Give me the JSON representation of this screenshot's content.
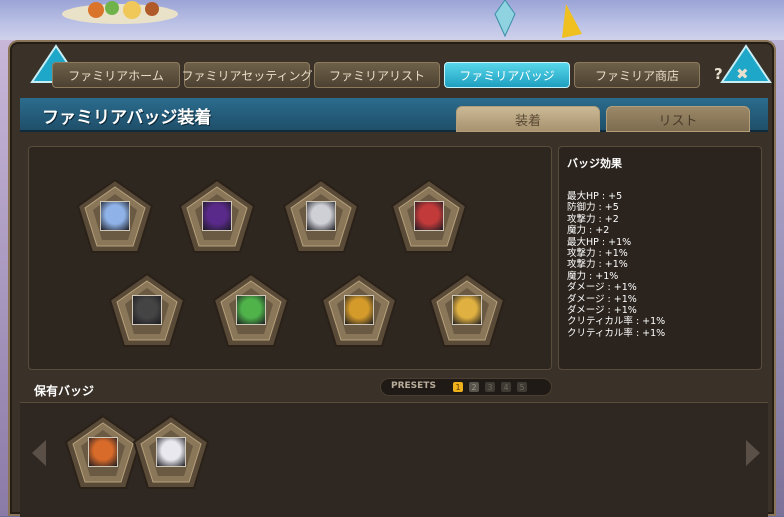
{
  "window": {
    "title": "ファミリアバッジ装着",
    "help_label": "?",
    "close_label": "✖"
  },
  "tabs": [
    {
      "label": "ファミリアホーム",
      "active": false
    },
    {
      "label": "ファミリアセッティング",
      "active": false
    },
    {
      "label": "ファミリアリスト",
      "active": false
    },
    {
      "label": "ファミリアバッジ",
      "active": true
    },
    {
      "label": "ファミリア商店",
      "active": false
    }
  ],
  "subtabs": [
    {
      "label": "装着",
      "active": true
    },
    {
      "label": "リスト",
      "active": false
    }
  ],
  "equipped_badges": [
    {
      "icon": "frost-feather-badge-icon",
      "color": "#8fb3e8"
    },
    {
      "icon": "dark-portal-badge-icon",
      "color": "#5a2a8a"
    },
    {
      "icon": "silver-box-badge-icon",
      "color": "#cfcfd6"
    },
    {
      "icon": "red-white-beast-badge-icon",
      "color": "#c23a3a"
    },
    {
      "icon": "shadow-golem-badge-icon",
      "color": "#444444"
    },
    {
      "icon": "witch-slime-badge-icon",
      "color": "#4fb34a"
    },
    {
      "icon": "golden-gear-badge-icon",
      "color": "#d59b2a"
    },
    {
      "icon": "golden-chest-badge-icon",
      "color": "#e0b040"
    }
  ],
  "effects": {
    "title": "バッジ効果",
    "lines": [
      "最大HP : +5",
      "防御力 : +5",
      "攻撃力 : +2",
      "魔力 : +2",
      "最大HP : +1%",
      "攻撃力 : +1%",
      "攻撃力 : +1%",
      "魔力 : +1%",
      "ダメージ : +1%",
      "ダメージ : +1%",
      "ダメージ : +1%",
      "クリティカル率 : +1%",
      "クリティカル率 : +1%"
    ]
  },
  "owned": {
    "label": "保有バッジ",
    "badges": [
      {
        "icon": "mushroom-friends-badge-icon",
        "color": "#d96b2a"
      },
      {
        "icon": "cloud-sheep-badge-icon",
        "color": "#e8e8ee"
      }
    ]
  },
  "presets": {
    "label": "PRESETS",
    "buttons": [
      "1",
      "2",
      "3",
      "4",
      "5"
    ],
    "selected": "1"
  },
  "colors": {
    "accent": "#2ab3d4",
    "window_bg": "#3a3128",
    "title_bar": "#2b6c8e",
    "preset_active": "#f0b21c"
  }
}
